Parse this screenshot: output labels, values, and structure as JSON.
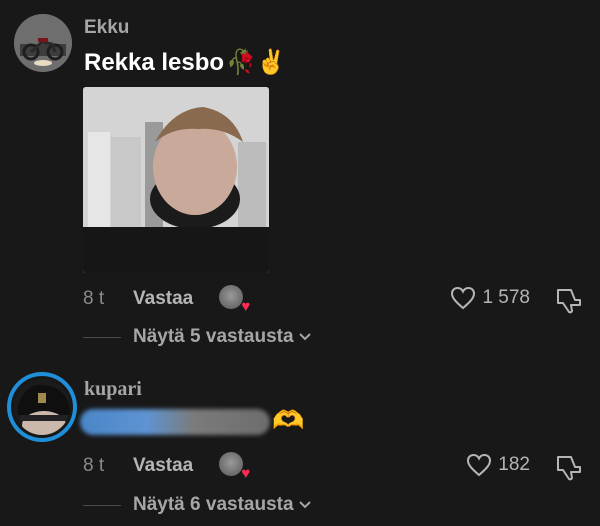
{
  "comments": [
    {
      "username": "Ekku",
      "text": "Rekka lesbo",
      "emoji": "🥀✌️",
      "time": "8 t",
      "reply_label": "Vastaa",
      "likes": "1 578",
      "view_replies": "Näytä 5 vastausta"
    },
    {
      "username": "kupari",
      "emoji": "🫶",
      "time": "8 t",
      "reply_label": "Vastaa",
      "likes": "182",
      "view_replies": "Näytä 6 vastausta"
    }
  ],
  "colors": {
    "background": "#181818",
    "accent_heart": "#fe2c55",
    "story_ring": "#1e8fd8"
  },
  "icons": [
    "heart-outline-icon",
    "thumbs-down-icon",
    "chevron-down-icon",
    "creator-liked-icon"
  ]
}
